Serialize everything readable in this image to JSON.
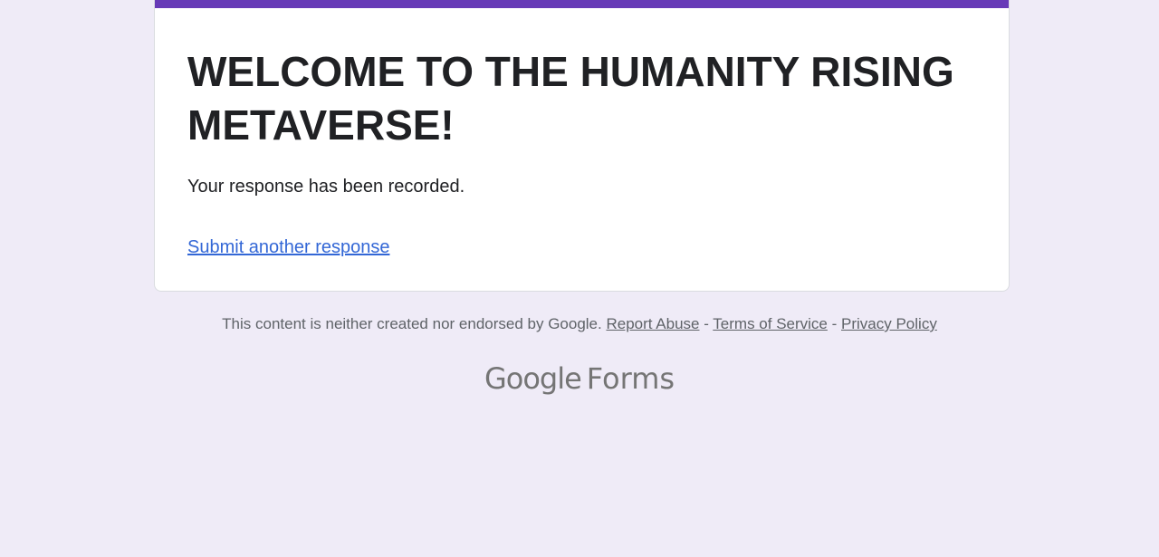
{
  "form": {
    "title": "WELCOME TO THE HUMANITY RISING METAVERSE!",
    "confirmation_message": "Your response has been recorded.",
    "submit_another_label": "Submit another response"
  },
  "footer": {
    "disclaimer": "This content is neither created nor endorsed by Google.",
    "report_abuse_label": "Report Abuse",
    "separator": "-",
    "terms_label": "Terms of Service",
    "privacy_label": "Privacy Policy"
  },
  "brand": {
    "google": "Google",
    "forms": "Forms"
  },
  "colors": {
    "accent": "#673ab7",
    "background": "#efebf7",
    "link": "#3367d6"
  }
}
